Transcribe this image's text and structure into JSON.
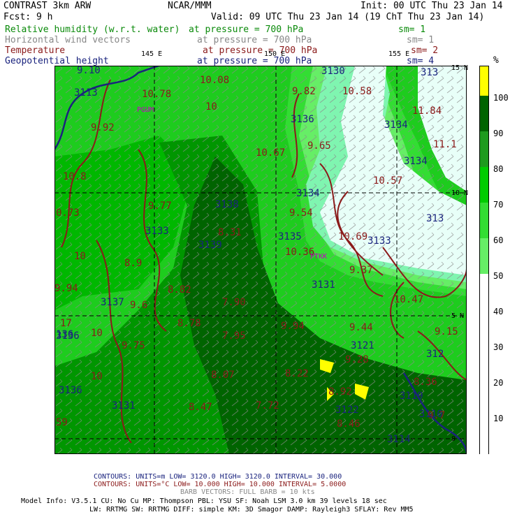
{
  "header": {
    "left_title": "CONTRAST  3km ARW",
    "center_title": "NCAR/MMM",
    "init": "Init: 00 UTC Thu 23 Jan 14",
    "fcst": "Fcst:   9 h",
    "valid": "Valid: 09 UTC Thu 23 Jan 14 (19 ChT Thu 23 Jan 14)"
  },
  "fields": [
    {
      "name": "Relative humidity (w.r.t. water)",
      "level": "at pressure =  700 hPa",
      "sm": "sm= 1",
      "color": "#0a8a0a"
    },
    {
      "name": "Horizontal wind vectors",
      "level": "at pressure =  700 hPa",
      "sm": "sm= 1",
      "color": "#888888"
    },
    {
      "name": "Temperature",
      "level": "at pressure =  700 hPa",
      "sm": "sm= 2",
      "color": "#8b1a1a"
    },
    {
      "name": "Geopotential height",
      "level": "at pressure =  700 hPa",
      "sm": "sm= 4",
      "color": "#1a237e"
    }
  ],
  "axes": {
    "lon_labels": [
      "145 E",
      "150 E",
      "155 E"
    ],
    "lat_labels": [
      "15 N",
      "10 N",
      "5 N",
      "0"
    ]
  },
  "colorbar": {
    "unit": "%",
    "ticks": [
      "100",
      "90",
      "80",
      "70",
      "60",
      "50",
      "40",
      "30",
      "20",
      "10"
    ],
    "colors": [
      "#ffff00",
      "#006400",
      "#1e9b1e",
      "#00cc00",
      "#33dd33",
      "#66ee66",
      "#66f0a0",
      "#ffffff",
      "#ffffff",
      "#ffffff",
      "#ffffff"
    ]
  },
  "stations": [
    "PGUM",
    "PTKK"
  ],
  "height_labels": [
    {
      "t": "3113",
      "kind": "H"
    },
    {
      "t": "3130"
    },
    {
      "t": "3136"
    },
    {
      "t": "3134"
    },
    {
      "t": "3134"
    },
    {
      "t": "3134"
    },
    {
      "t": "3138"
    },
    {
      "t": "3133"
    },
    {
      "t": "3139"
    },
    {
      "t": "3135"
    },
    {
      "t": "3133"
    },
    {
      "t": "3131"
    },
    {
      "t": "3137"
    },
    {
      "t": "3136"
    },
    {
      "t": "3136"
    },
    {
      "t": "3131"
    },
    {
      "t": "3121"
    },
    {
      "t": "3122"
    },
    {
      "t": "3119"
    },
    {
      "t": "3114"
    },
    {
      "t": "313"
    },
    {
      "t": "313"
    },
    {
      "t": "312"
    },
    {
      "t": "3110"
    }
  ],
  "temp_labels": [
    "10.78",
    "10.08",
    "9.82",
    "10.58",
    "11.84",
    "9.92",
    "9.65",
    "10.67",
    "11.1",
    "10.8",
    "10.57",
    "9.77",
    "9.54",
    "0.73",
    "8.31",
    "10.69",
    "10.36",
    "8.9",
    "9.37",
    "9.94",
    "8.82",
    "9.6",
    "7.90",
    "10.47",
    "8.78",
    "9.94",
    "9.44",
    "9.75",
    "7.95",
    "9.28",
    "8.07",
    "8.22",
    "8.92",
    "8.47",
    "7.72",
    "8.46",
    "8.36",
    "9.15",
    "9.7",
    "17",
    "136",
    "59",
    "9.10",
    "10",
    "10",
    "10",
    "10"
  ],
  "footer": {
    "contours1": "CONTOURS:  UNITS=m   LOW=  3120.0      HIGH=  3120.0      INTERVAL=  30.000",
    "contours2": "CONTOURS:  UNITS=°C  LOW=  10.000      HIGH=  10.000      INTERVAL=  5.0000",
    "barbs": "BARB VECTORS:  FULL BARB = 10 kts",
    "model1": "Model Info: V3.5.1    CU: No Cu    MP: Thompson    PBL: YSU      SF: Noah LSM    3.0 km   39 levels   18 sec",
    "model2": "LW: RRTMG   SW: RRTMG  DIFF: simple KM: 3D Smagor DAMP: Rayleigh3  SFLAY: Rev MM5"
  }
}
